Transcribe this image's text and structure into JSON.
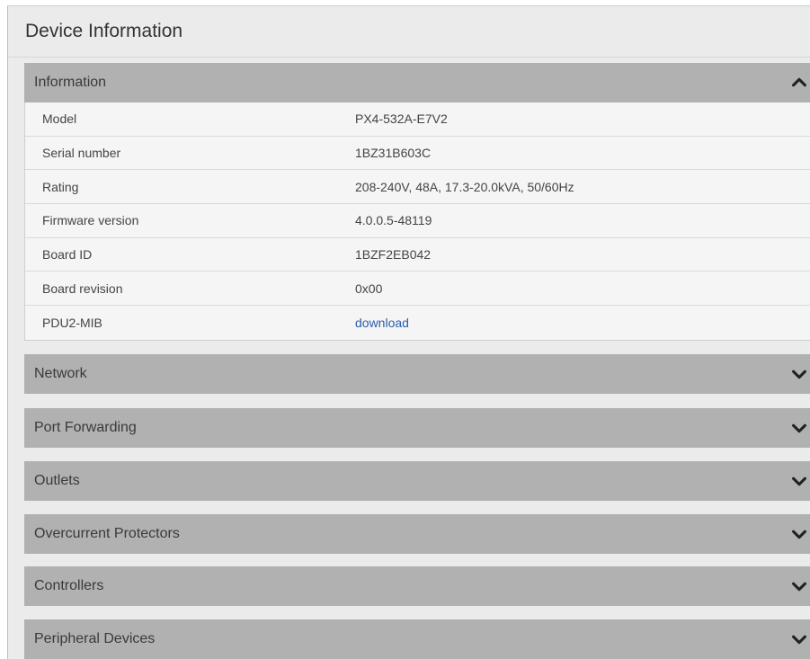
{
  "panel": {
    "title": "Device Information"
  },
  "information": {
    "label": "Information",
    "rows": [
      {
        "key": "Model",
        "value": "PX4-532A-E7V2"
      },
      {
        "key": "Serial number",
        "value": "1BZ31B603C"
      },
      {
        "key": "Rating",
        "value": "208-240V, 48A, 17.3-20.0kVA, 50/60Hz"
      },
      {
        "key": "Firmware version",
        "value": "4.0.0.5-48119"
      },
      {
        "key": "Board ID",
        "value": "1BZF2EB042"
      },
      {
        "key": "Board revision",
        "value": "0x00"
      },
      {
        "key": "PDU2-MIB",
        "value": "download"
      }
    ]
  },
  "sections": [
    {
      "label": "Network"
    },
    {
      "label": "Port Forwarding"
    },
    {
      "label": "Outlets"
    },
    {
      "label": "Overcurrent Protectors"
    },
    {
      "label": "Controllers"
    },
    {
      "label": "Peripheral Devices"
    }
  ],
  "colors": {
    "section_header": "#b1b1b1",
    "panel_bg": "#ebebeb",
    "link": "#2a5db0"
  },
  "icons": {
    "expanded": "chevron-up-icon",
    "collapsed": "chevron-down-icon"
  }
}
